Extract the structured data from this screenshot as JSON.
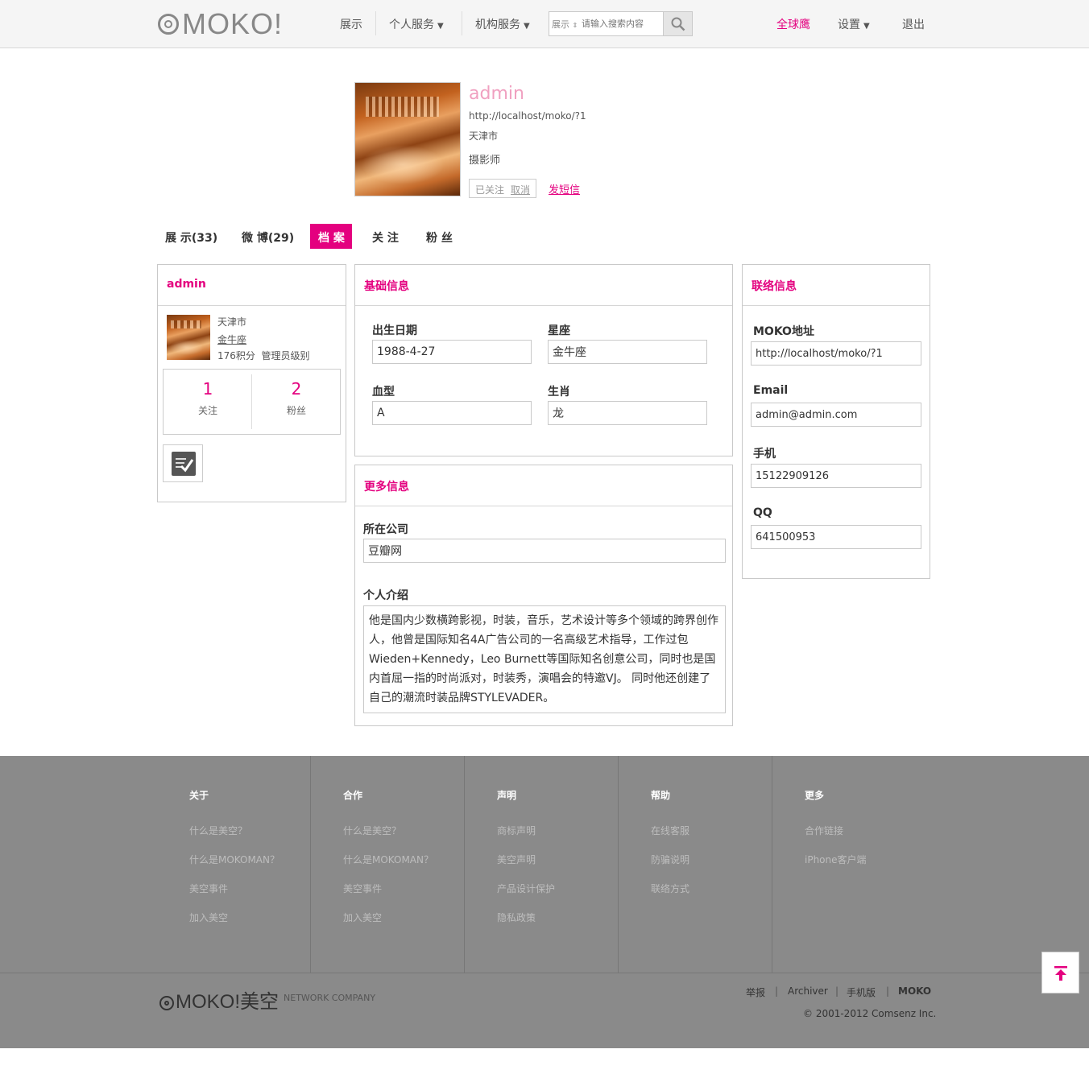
{
  "colors": {
    "accent": "#e4007f",
    "name_pink": "#f0a0c0",
    "footer_bg": "#8a8a8a"
  },
  "header": {
    "logo_text": "MOKO!",
    "nav": {
      "showcase": "展示",
      "personal_services": "个人服务",
      "org_services": "机构服务"
    },
    "search": {
      "type": "展示",
      "placeholder": "请输入搜索内容",
      "icon": "search-icon"
    },
    "global_hawk": "全球鹰",
    "settings": "设置",
    "logout": "退出"
  },
  "profile": {
    "name": "admin",
    "url": "http://localhost/moko/?1",
    "city": "天津市",
    "occupation": "摄影师",
    "followed": "已关注",
    "cancel": "取消",
    "send_message": "发短信"
  },
  "tabs": [
    {
      "label": "展 示(33)"
    },
    {
      "label": "微 博(29)"
    },
    {
      "label": "档 案",
      "active": true
    },
    {
      "label": "关 注"
    },
    {
      "label": "粉 丝"
    }
  ],
  "left_panel": {
    "title": "admin",
    "city": "天津市",
    "zodiac": "金牛座",
    "points": "176积分",
    "level": "管理员级别",
    "following_count": "1",
    "following_label": "关注",
    "fans_count": "2",
    "fans_label": "粉丝",
    "checkin_icon": "checkin-icon"
  },
  "basic_info": {
    "title": "基础信息",
    "birthday_label": "出生日期",
    "birthday": "1988-4-27",
    "constellation_label": "星座",
    "constellation": "金牛座",
    "blood_label": "血型",
    "blood": "A",
    "chinese_zodiac_label": "生肖",
    "chinese_zodiac": "龙"
  },
  "more_info": {
    "title": "更多信息",
    "company_label": "所在公司",
    "company": "豆瓣网",
    "bio_label": "个人介绍",
    "bio": "他是国内少数横跨影视，时装，音乐，艺术设计等多个领域的跨界创作人，他曾是国际知名4A广告公司的一名高级艺术指导，工作过包Wieden+Kennedy，Leo Burnett等国际知名创意公司，同时也是国内首屈一指的时尚派对，时装秀，演唱会的特邀VJ。 同时他还创建了自己的潮流时装品牌STYLEVADER。"
  },
  "contact": {
    "title": "联络信息",
    "moko_label": "MOKO地址",
    "moko": "http://localhost/moko/?1",
    "email_label": "Email",
    "email": "admin@admin.com",
    "phone_label": "手机",
    "phone": "15122909126",
    "qq_label": "QQ",
    "qq": "641500953"
  },
  "footer": {
    "columns": [
      {
        "title": "关于",
        "links": [
          "什么是美空？",
          "什么是MOKOMAN？",
          "美空事件",
          "加入美空"
        ]
      },
      {
        "title": "合作",
        "links": [
          "什么是美空？",
          "什么是MOKOMAN？",
          "美空事件",
          "加入美空"
        ]
      },
      {
        "title": "声明",
        "links": [
          "商标声明",
          "美空声明",
          "产品设计保护",
          "隐私政策"
        ]
      },
      {
        "title": "帮助",
        "links": [
          "在线客服",
          "防骗说明",
          "联络方式"
        ]
      },
      {
        "title": "更多",
        "links": [
          "合作链接",
          "iPhone客户端"
        ]
      }
    ],
    "logo_text": "MOKO!美空",
    "logo_sub": "NETWORK COMPANY",
    "right_links": [
      "举报",
      "Archiver",
      "手机版",
      "MOKO"
    ],
    "separator": "|",
    "copyright": "© 2001-2012 Comsenz Inc."
  }
}
